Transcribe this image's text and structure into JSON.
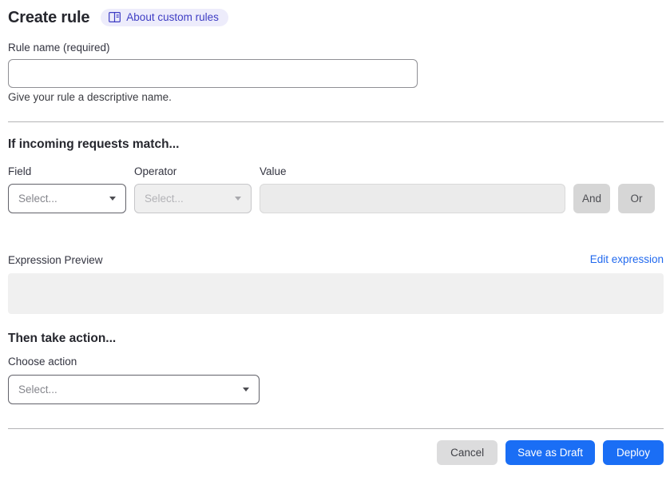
{
  "header": {
    "title": "Create rule",
    "about_label": "About custom rules"
  },
  "rule_name": {
    "label": "Rule name (required)",
    "value": "",
    "helper": "Give your rule a descriptive name."
  },
  "match": {
    "heading": "If incoming requests match...",
    "field_label": "Field",
    "operator_label": "Operator",
    "value_label": "Value",
    "field_placeholder": "Select...",
    "operator_placeholder": "Select...",
    "value_value": "",
    "and_label": "And",
    "or_label": "Or"
  },
  "expression": {
    "label": "Expression Preview",
    "edit_link": "Edit expression",
    "content": ""
  },
  "action": {
    "heading": "Then take action...",
    "label": "Choose action",
    "placeholder": "Select..."
  },
  "footer": {
    "cancel_label": "Cancel",
    "save_draft_label": "Save as Draft",
    "deploy_label": "Deploy"
  },
  "colors": {
    "accent_blue": "#1a6ef5",
    "link_blue": "#2169ee",
    "pill_bg": "#edecfb",
    "pill_text": "#3e3dc4"
  }
}
